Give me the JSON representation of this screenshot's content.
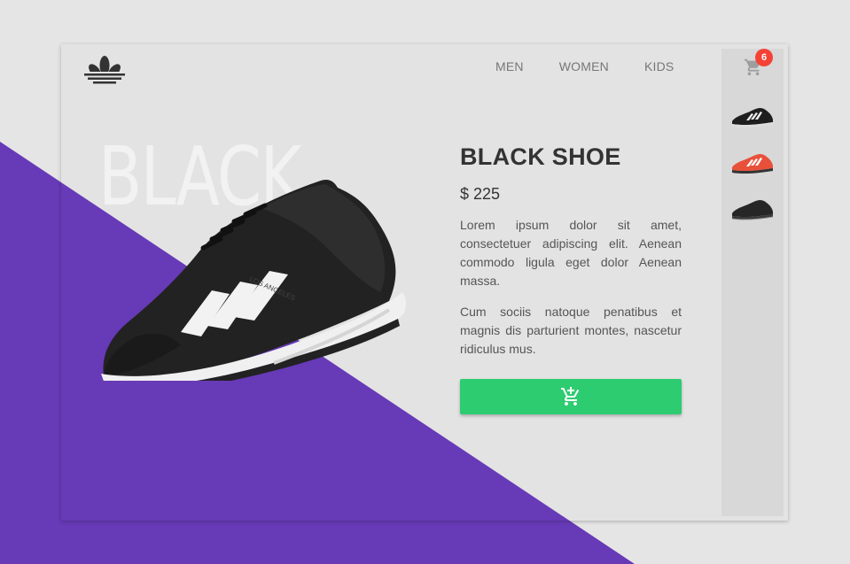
{
  "brand": {
    "logo_icon": "adidas-trefoil-icon"
  },
  "nav": {
    "items": [
      "MEN",
      "WOMEN",
      "KIDS"
    ]
  },
  "product": {
    "background_word": "BLACK",
    "title": "BLACK SHOE",
    "price": "$ 225",
    "description": [
      "Lorem ipsum dolor sit amet, consectetuer adipiscing elit. Aenean commodo ligula eget dolor Aenean massa.",
      "Cum sociis natoque penatibus et magnis dis parturient montes, nascetur ridiculus mus."
    ],
    "shoe_print": "LOS ANGELES",
    "add_to_cart_icon": "add-shopping-cart-icon"
  },
  "cart": {
    "count": "6",
    "icon": "shopping-cart-icon"
  },
  "thumbnails": [
    {
      "name": "black-white-stripes-shoe",
      "color": "#1e1e1e"
    },
    {
      "name": "red-shoe",
      "color": "#e8503a"
    },
    {
      "name": "black-shoe",
      "color": "#262626"
    }
  ],
  "colors": {
    "accent_purple": "#673ab7",
    "button_green": "#2ecc71",
    "badge_red": "#f44336"
  }
}
